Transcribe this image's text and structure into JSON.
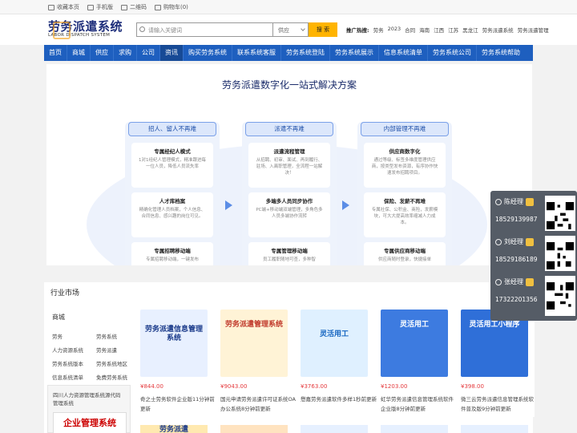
{
  "topbar": {
    "links": [
      "收藏本页",
      "手机版",
      "二维码",
      "购物车(0)"
    ]
  },
  "header": {
    "logo_title": "劳务派遣系统",
    "logo_sub": "LABOR DISPATCH SYSTEM",
    "search_placeholder": "请输入关键词",
    "search_scope": "供应",
    "search_button": "搜 索",
    "hot_label": "推广热搜:",
    "hot_terms": [
      "劳务",
      "2023",
      "合同",
      "海南",
      "江西",
      "江苏",
      "黑龙江",
      "劳务派遣系统",
      "劳务派遣管理"
    ]
  },
  "nav": {
    "items": [
      "首页",
      "商城",
      "供应",
      "求购",
      "公司",
      "资讯",
      "购买劳务系统",
      "联系系统客服",
      "劳务系统登陆",
      "劳务系统展示",
      "信息系统清单",
      "劳务系统公司",
      "劳务系统帮助"
    ],
    "active_index": 5
  },
  "hero": {
    "title": "劳务派遣数字化一站式解决方案",
    "columns": [
      {
        "title": "招人、留人不再难",
        "cards": [
          {
            "t": "专属经纪人模式",
            "d": "1对1经纪人管理模式，精准跟进每一位人员，降低人员流失率"
          },
          {
            "t": "人才库档案",
            "d": "精确化管理人员档案，个人信息、合同信息、感兴趣的岗位可见。"
          },
          {
            "t": "专属招聘移动端",
            "d": "专属招聘移动端，一键发布"
          }
        ]
      },
      {
        "title": "派遣不再难",
        "cards": [
          {
            "t": "派遣流程管理",
            "d": "从招聘、初审、面试、再到履行、驻场、入离职管理，全流程一站解决！"
          },
          {
            "t": "多端多人员同步协作",
            "d": "PC端+移动端双端管理，多角色多人员多端协作流转"
          },
          {
            "t": "专属管理移动端",
            "d": "员工履职随地可查，多种智"
          }
        ]
      },
      {
        "title": "内部管理不再难",
        "cards": [
          {
            "t": "供应商数字化",
            "d": "通过等级、标签多维度管理供应商，按类型发布资源，有序协作快速发布招聘项目。"
          },
          {
            "t": "保险、发薪不再难",
            "d": "专属社保、公积金、商险，发薪模块，可大大提高效率缩减人力成本。"
          },
          {
            "t": "专属供应商移动端",
            "d": "供应商随时登录，快捷接单"
          }
        ]
      }
    ]
  },
  "market": {
    "title": "行业市场",
    "tabs": [
      "供应",
      "求购"
    ],
    "sidebar_title": "商城",
    "sidebar_links": [
      "劳务",
      "劳务系统",
      "人力资源系统",
      "劳务派遣",
      "劳务系统版本",
      "劳务系统地区",
      "信息系统清单",
      "免费劳务系统"
    ],
    "sidebar_box_text": "四川人力资源管理系统源代码管理系统",
    "sidebar_box_image_text": "企业管理系统",
    "products": [
      {
        "price": "¥844.00",
        "desc": "奇之士劳务软件企业版11分钟前更新",
        "img": "劳务派遣信息管理系统"
      },
      {
        "price": "¥9043.00",
        "desc": "国元申请劳务派遣许可证系统OA办公系统8分钟前更新",
        "img": "劳务派遣管理系统"
      },
      {
        "price": "¥3763.00",
        "desc": "懋嘉劳务派遣软件多样1秒前更新",
        "img": "灵活用工"
      },
      {
        "price": "¥1203.00",
        "desc": "虹华劳务派遣信息管理系统软件企业版8分钟前更新",
        "img": "灵活用工"
      },
      {
        "price": "¥398.00",
        "desc": "微三云劳务派遣信息管理系统软件普及版9分钟前更新",
        "img": "灵活用工小程序"
      }
    ],
    "products_row2_text": "劳务派遣"
  },
  "contacts": [
    {
      "name": "陈经理",
      "phone": "18529139987"
    },
    {
      "name": "刘经理",
      "phone": "18529186189"
    },
    {
      "name": "张经理",
      "phone": "17322201356"
    }
  ],
  "colors": {
    "nav": "#1e5fbf",
    "search_button": "#ffb400",
    "price": "#e4393c",
    "float_bg": "#555c66"
  }
}
